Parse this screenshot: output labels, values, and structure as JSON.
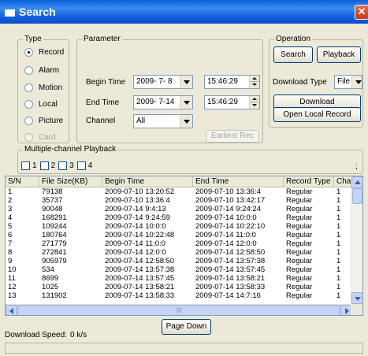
{
  "window": {
    "title": "Search",
    "close_icon": "close-icon"
  },
  "type_group": {
    "legend": "Type",
    "options": [
      {
        "label": "Record",
        "selected": true,
        "disabled": false
      },
      {
        "label": "Alarm",
        "selected": false,
        "disabled": false
      },
      {
        "label": "Motion",
        "selected": false,
        "disabled": false
      },
      {
        "label": "Local",
        "selected": false,
        "disabled": false
      },
      {
        "label": "Picture",
        "selected": false,
        "disabled": false
      },
      {
        "label": "Card",
        "selected": false,
        "disabled": true
      }
    ]
  },
  "parameter_group": {
    "legend": "Parameter",
    "begin_time_label": "Begin Time",
    "begin_date": "2009- 7- 8",
    "begin_clock": "15:46:29",
    "end_time_label": "End Time",
    "end_date": "2009- 7-14",
    "end_clock": "15:46:29",
    "channel_label": "Channel",
    "channel_value": "All",
    "earliest_rec_label": "Earliest Rec"
  },
  "operation_group": {
    "legend": "Operation",
    "search_label": "Search",
    "playback_label": "Playback",
    "download_type_label": "Download Type",
    "download_type_value": "File",
    "download_label": "Download",
    "open_local_record_label": "Open Local Record"
  },
  "multichannel": {
    "legend": "Multiple-channel Playback",
    "checkboxes": [
      "1",
      "2",
      "3",
      "4"
    ],
    "extra_mark": ";"
  },
  "table": {
    "columns": [
      "S/N",
      "File Size(KB)",
      "Begin Time",
      "End Time",
      "Record Type",
      "Chan"
    ],
    "rows": [
      [
        "1",
        "79138",
        "2009-07-10 13:20:52",
        "2009-07-10 13:36:4",
        "Regular",
        "1"
      ],
      [
        "2",
        "35737",
        "2009-07-10 13:36:4",
        "2009-07-10 13:42:17",
        "Regular",
        "1"
      ],
      [
        "3",
        "90048",
        "2009-07-14 9:4:13",
        "2009-07-14 9:24:24",
        "Regular",
        "1"
      ],
      [
        "4",
        "168291",
        "2009-07-14 9:24:59",
        "2009-07-14 10:0:0",
        "Regular",
        "1"
      ],
      [
        "5",
        "109244",
        "2009-07-14 10:0:0",
        "2009-07-14 10:22:10",
        "Regular",
        "1"
      ],
      [
        "6",
        "180764",
        "2009-07-14 10:22:48",
        "2009-07-14 11:0:0",
        "Regular",
        "1"
      ],
      [
        "7",
        "271779",
        "2009-07-14 11:0:0",
        "2009-07-14 12:0:0",
        "Regular",
        "1"
      ],
      [
        "8",
        "272841",
        "2009-07-14 12:0:0",
        "2009-07-14 12:58:50",
        "Regular",
        "1"
      ],
      [
        "9",
        "905979",
        "2009-07-14 12:58:50",
        "2009-07-14 13:57:38",
        "Regular",
        "1"
      ],
      [
        "10",
        "534",
        "2009-07-14 13:57:38",
        "2009-07-14 13:57:45",
        "Regular",
        "1"
      ],
      [
        "11",
        "8699",
        "2009-07-14 13:57:45",
        "2009-07-14 13:58:21",
        "Regular",
        "1"
      ],
      [
        "12",
        "1025",
        "2009-07-14 13:58:21",
        "2009-07-14 13:58:33",
        "Regular",
        "1"
      ],
      [
        "13",
        "131902",
        "2009-07-14 13:58:33",
        "2009-07-14 14:7:16",
        "Regular",
        "1"
      ]
    ]
  },
  "page_down_label": "Page Down",
  "download_speed_label": "Download Speed:",
  "download_speed_value": "0 k/s"
}
